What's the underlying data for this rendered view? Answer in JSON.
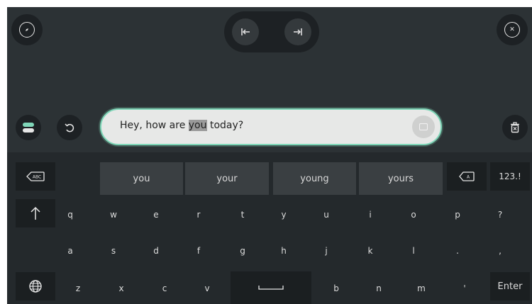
{
  "toolbar": {
    "left_icon": "compass-icon",
    "prev_icon": "jump-to-start-icon",
    "next_icon": "jump-to-end-icon",
    "close_icon": "close-circle-icon"
  },
  "input_bar": {
    "text_before": "Hey, how are ",
    "text_highlight": "you",
    "text_after": " today?"
  },
  "suggestions": [
    "you",
    "your",
    "young",
    "yours"
  ],
  "keys": {
    "abc_label": "ABC",
    "mode_label": "123.!",
    "enter_label": "Enter",
    "row1": [
      "q",
      "w",
      "e",
      "r",
      "t",
      "y",
      "u",
      "i",
      "o",
      "p",
      "?"
    ],
    "row2": [
      "a",
      "s",
      "d",
      "f",
      "g",
      "h",
      "j",
      "k",
      "l",
      ".",
      ","
    ],
    "row3": [
      "z",
      "x",
      "c",
      "v",
      "b",
      "n",
      "m",
      "'"
    ]
  },
  "colors": {
    "accent": "#7fd6b8",
    "background": "#24292c",
    "suggestion_bg": "#3a3f42"
  }
}
